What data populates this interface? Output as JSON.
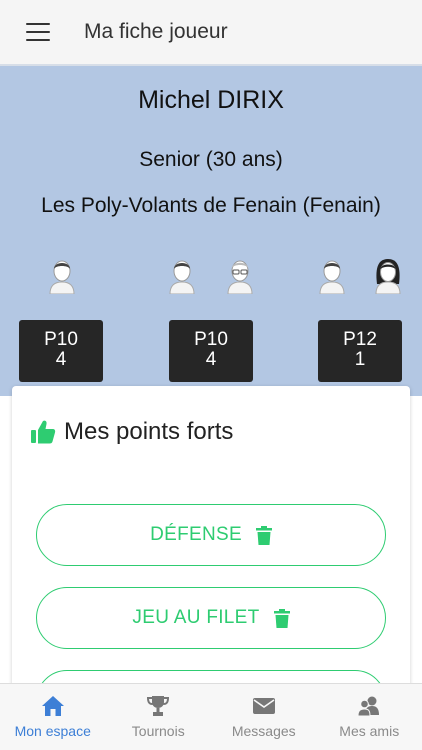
{
  "appbar": {
    "title": "Ma fiche joueur",
    "menu_icon": "hamburger-menu-icon"
  },
  "player": {
    "name": "Michel DIRIX",
    "category": "Senior (30 ans)",
    "club": "Les Poly-Volants de Fenain (Fenain)"
  },
  "rankings": [
    {
      "discipline_icons": [
        "male-player-icon"
      ],
      "rank": "P10",
      "value": "4"
    },
    {
      "discipline_icons": [
        "male-player-icon",
        "male-player-glasses-icon"
      ],
      "rank": "P10",
      "value": "4"
    },
    {
      "discipline_icons": [
        "male-player-icon",
        "female-player-icon"
      ],
      "rank": "P12",
      "value": "1"
    }
  ],
  "strengths": {
    "title": "Mes points forts",
    "icon": "thumbs-up-icon",
    "items": [
      {
        "label": "DÉFENSE",
        "icon": "trash-icon"
      },
      {
        "label": "JEU AU FILET",
        "icon": "trash-icon"
      }
    ]
  },
  "colors": {
    "hero_bg": "#b3c7e3",
    "accent_green": "#2ecc71",
    "active_nav": "#3d7fd6",
    "rank_bg": "#262626"
  },
  "bottom_nav": [
    {
      "label": "Mon espace",
      "icon": "home-icon",
      "active": true
    },
    {
      "label": "Tournois",
      "icon": "trophy-icon",
      "active": false
    },
    {
      "label": "Messages",
      "icon": "envelope-icon",
      "active": false
    },
    {
      "label": "Mes amis",
      "icon": "friends-icon",
      "active": false
    }
  ]
}
